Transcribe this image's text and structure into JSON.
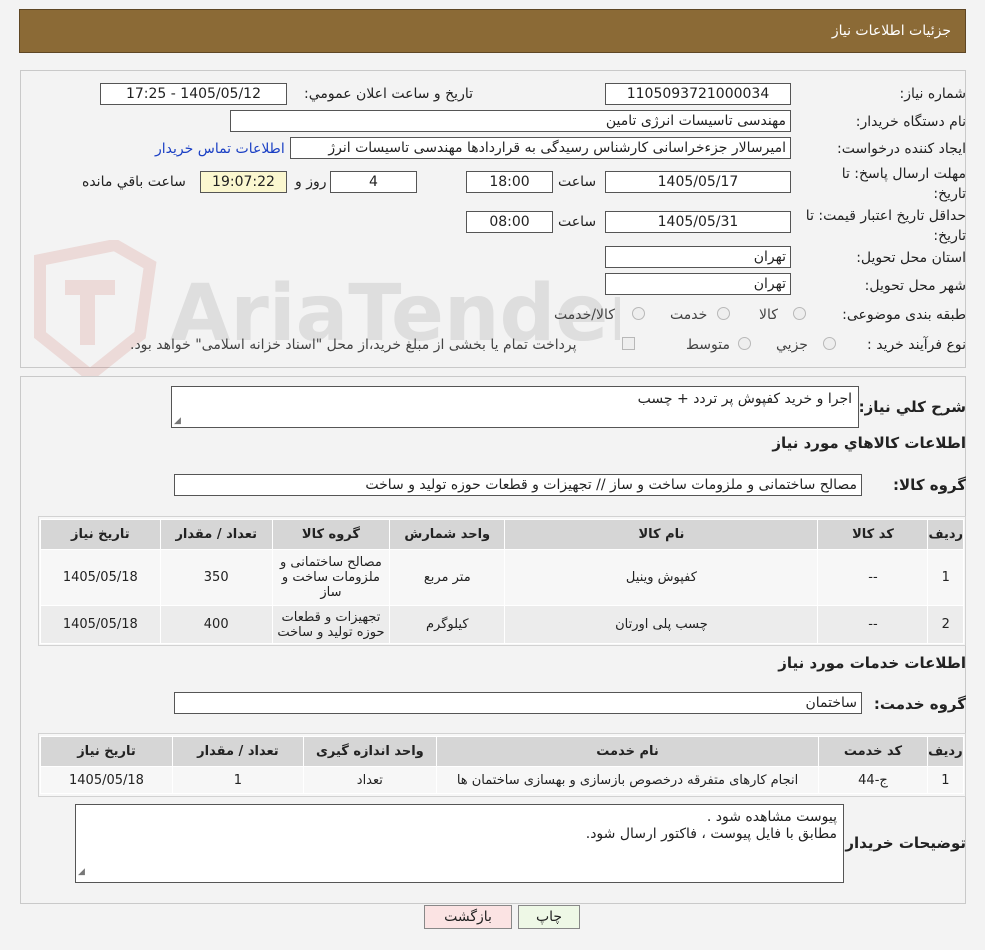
{
  "header": {
    "title": "جزئیات اطلاعات نیاز"
  },
  "watermark": {
    "text": "AriaTender.neT"
  },
  "form": {
    "need_number_label": "شماره نیاز:",
    "need_number": "1105093721000034",
    "announce_label": "تاریخ و ساعت اعلان عمومي:",
    "announce_value": "1405/05/12 - 17:25",
    "buyer_label": "نام دستگاه خريدار:",
    "buyer_value": "مهندسی تاسیسات انرژی تامین",
    "creator_label": "ايجاد كننده درخواست:",
    "creator_value": "امیرسالار جزءخراسانی کارشناس رسیدگی به قراردادها مهندسی تاسیسات انرژ",
    "contact_link": "اطلاعات تماس خريدار",
    "deadline_label": "مهلت ارسال پاسخ: تا تاريخ:",
    "deadline_date": "1405/05/17",
    "time_label": "ساعت",
    "deadline_time": "18:00",
    "days_value": "4",
    "days_label": "روز و",
    "remaining_time": "19:07:22",
    "remaining_label": "ساعت باقي مانده",
    "validity_label": "حداقل تاريخ اعتبار قيمت: تا تاريخ:",
    "validity_date": "1405/05/31",
    "validity_time": "08:00",
    "province_label": "استان محل تحويل:",
    "province_value": "تهران",
    "city_label": "شهر محل تحويل:",
    "city_value": "تهران",
    "category_label": "طبقه بندی موضوعی:",
    "category_options": [
      "كالا",
      "خدمت",
      "كالا/خدمت"
    ],
    "process_label": "نوع فرآيند خريد :",
    "process_options": [
      "جزيي",
      "متوسط"
    ],
    "process_note": "پرداخت تمام يا بخشی از مبلغ خريد،از محل \"اسناد خزانه اسلامی\" خواهد بود."
  },
  "summary": {
    "desc_label": "شرح كلي نياز:",
    "desc_value": "اجرا و خرید کفپوش پر تردد + چسب",
    "goods_heading": "اطلاعات كالاهاي مورد نياز",
    "goods_group_label": "گروه كالا:",
    "goods_group_value": "مصالح ساختمانی و ملزومات ساخت و ساز // تجهیزات و قطعات حوزه تولید و ساخت"
  },
  "goods_table": {
    "headers": [
      "رديف",
      "كد كالا",
      "نام كالا",
      "واحد شمارش",
      "گروه كالا",
      "تعداد / مقدار",
      "تاريخ نياز"
    ],
    "rows": [
      [
        "1",
        "--",
        "کفپوش وینیل",
        "متر مربع",
        "مصالح ساختمانی و ملزومات ساخت و ساز",
        "350",
        "1405/05/18"
      ],
      [
        "2",
        "--",
        "چسب پلی اورتان",
        "کیلوگرم",
        "تجهیزات و قطعات حوزه تولید و ساخت",
        "400",
        "1405/05/18"
      ]
    ]
  },
  "services": {
    "heading": "اطلاعات خدمات مورد نياز",
    "group_label": "گروه خدمت:",
    "group_value": "ساختمان"
  },
  "services_table": {
    "headers": [
      "رديف",
      "كد خدمت",
      "نام خدمت",
      "واحد اندازه گيری",
      "تعداد / مقدار",
      "تاريخ نياز"
    ],
    "rows": [
      [
        "1",
        "ج-44",
        "انجام کارهای متفرقه درخصوص بازسازی و بهسازی ساختمان ها",
        "تعداد",
        "1",
        "1405/05/18"
      ]
    ]
  },
  "notes": {
    "label": "توضيحات خريدار:",
    "line1": "پیوست مشاهده شود .",
    "line2": "مطابق با فایل پیوست ، فاکتور ارسال شود."
  },
  "buttons": {
    "print": "چاپ",
    "back": "بازگشت"
  }
}
